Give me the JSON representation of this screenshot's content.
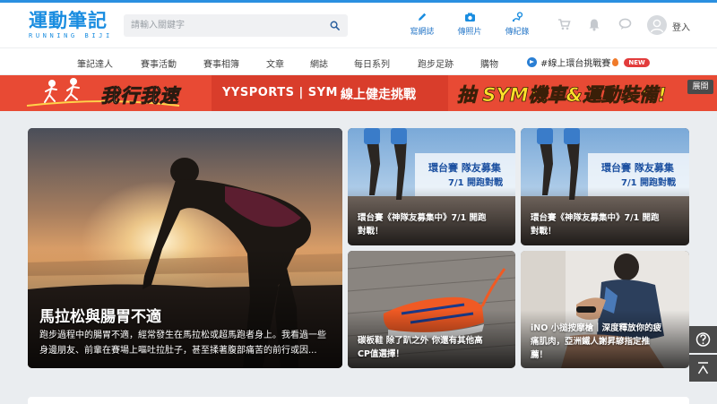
{
  "brand": {
    "name": "運動筆記",
    "sub": "RUNNING BIJI",
    "accent": "#1a8de0"
  },
  "search": {
    "placeholder": "請輸入關鍵字"
  },
  "header_actions": [
    {
      "label": "寫網誌",
      "icon": "pencil-icon"
    },
    {
      "label": "傳照片",
      "icon": "camera-icon"
    },
    {
      "label": "傳紀錄",
      "icon": "route-icon"
    }
  ],
  "header_icons": [
    "cart-icon",
    "bell-icon",
    "chat-icon"
  ],
  "user": {
    "login_label": "登入"
  },
  "nav": {
    "items": [
      "筆記達人",
      "賽事活動",
      "賽事相簿",
      "文章",
      "網誌",
      "每日系列",
      "跑步足跡",
      "購物"
    ],
    "special": {
      "label": "#線上環台挑戰賽",
      "badge": "NEW"
    }
  },
  "banner": {
    "slogan": "我行我速",
    "sponsor_text": "YYSPORTS | SYM",
    "event_text": "線上健走挑戰",
    "lottery_text": "抽 SYM機車&運動裝備!",
    "expand_label": "展開",
    "color": "#e84a34"
  },
  "featured": {
    "title": "馬拉松與腸胃不適",
    "excerpt_line1": "跑步過程中的腸胃不適，經常發生在馬拉松或超馬跑者身上。我看過一些",
    "excerpt_line2": "身邊朋友、前輩在賽場上嘔吐拉肚子，甚至揉著腹部痛苦的前行或因..."
  },
  "cards": [
    {
      "title_line1": "環台賽《神隊友募集中》7/1 開跑",
      "title_line2": "對戰！",
      "poster_line1": "環台賽 隊友募集",
      "poster_line2": "7/1 開跑對戰"
    },
    {
      "title_line1": "環台賽《神隊友募集中》7/1 開跑",
      "title_line2": "對戰！",
      "poster_line1": "環台賽 隊友募集",
      "poster_line2": "7/1 開跑對戰"
    },
    {
      "title_line1": "碳板鞋 除了趴之外 你還有其他高",
      "title_line2": "CP值選擇！"
    },
    {
      "title_line1": "iNO 小搥按摩槍｜深度釋放你的疲",
      "title_line2": "痛肌肉，亞洲鐵人謝昇諺指定推",
      "title_line3": "薦！"
    }
  ],
  "side_tools": [
    "help-icon",
    "back-to-top-icon"
  ]
}
